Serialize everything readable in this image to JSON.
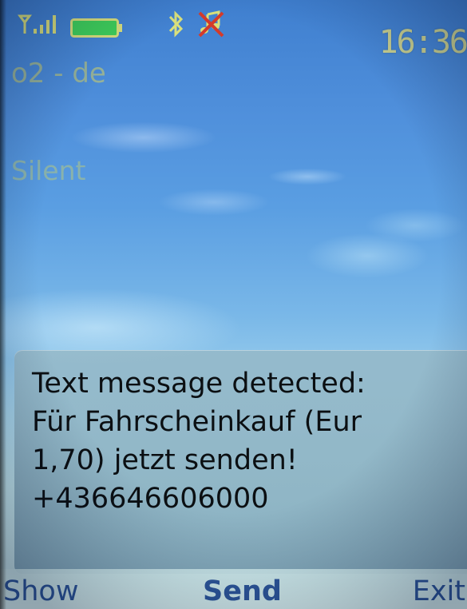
{
  "status_bar": {
    "signal_icon": "signal-antenna-icon",
    "battery_icon": "battery-icon",
    "bluetooth_icon": "bluetooth-icon",
    "silent_icon": "silent-profile-icon",
    "clock": "16:36",
    "indicator_color": "#e3e38c",
    "battery_color": "#3fcf5a"
  },
  "operator": "o2 - de",
  "profile": "Silent",
  "message": {
    "lines": [
      "Text message detected:",
      "Für Fahrscheinkauf (Eur",
      "1,70) jetzt senden!",
      "+436646606000"
    ]
  },
  "softkeys": {
    "left": "Show",
    "middle": "Send",
    "right": "Exit",
    "color": "#2f5aa0"
  }
}
